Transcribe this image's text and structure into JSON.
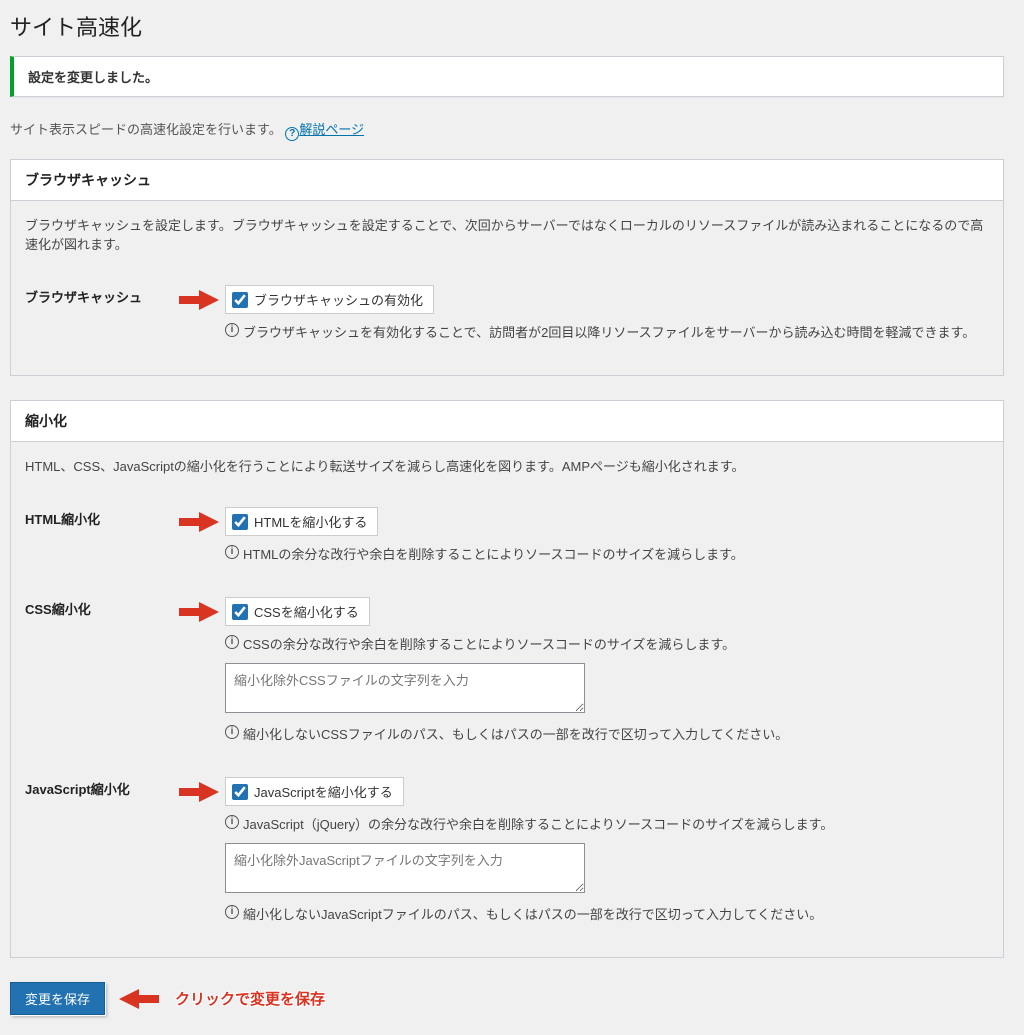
{
  "page_title": "サイト高速化",
  "notice": "設定を変更しました。",
  "intro_text": "サイト表示スピードの高速化設定を行います。",
  "help_link_text": "解説ページ",
  "sections": {
    "cache": {
      "title": "ブラウザキャッシュ",
      "desc": "ブラウザキャッシュを設定します。ブラウザキャッシュを設定することで、次回からサーバーではなくローカルのリソースファイルが読み込まれることになるので高速化が図れます。",
      "row_label": "ブラウザキャッシュ",
      "checkbox_label": "ブラウザキャッシュの有効化",
      "checkbox_checked": true,
      "hint": "ブラウザキャッシュを有効化することで、訪問者が2回目以降リソースファイルをサーバーから読み込む時間を軽減できます。"
    },
    "minify": {
      "title": "縮小化",
      "desc": "HTML、CSS、JavaScriptの縮小化を行うことにより転送サイズを減らし高速化を図ります。AMPページも縮小化されます。",
      "html": {
        "row_label": "HTML縮小化",
        "checkbox_label": "HTMLを縮小化する",
        "checkbox_checked": true,
        "hint": "HTMLの余分な改行や余白を削除することによりソースコードのサイズを減らします。"
      },
      "css": {
        "row_label": "CSS縮小化",
        "checkbox_label": "CSSを縮小化する",
        "checkbox_checked": true,
        "hint": "CSSの余分な改行や余白を削除することによりソースコードのサイズを減らします。",
        "exclude_placeholder": "縮小化除外CSSファイルの文字列を入力",
        "exclude_value": "",
        "exclude_hint": "縮小化しないCSSファイルのパス、もしくはパスの一部を改行で区切って入力してください。"
      },
      "js": {
        "row_label": "JavaScript縮小化",
        "checkbox_label": "JavaScriptを縮小化する",
        "checkbox_checked": true,
        "hint": "JavaScript（jQuery）の余分な改行や余白を削除することによりソースコードのサイズを減らします。",
        "exclude_placeholder": "縮小化除外JavaScriptファイルの文字列を入力",
        "exclude_value": "",
        "exclude_hint": "縮小化しないJavaScriptファイルのパス、もしくはパスの一部を改行で区切って入力してください。"
      }
    }
  },
  "save_button_label": "変更を保存",
  "save_annotation": "クリックで変更を保存"
}
